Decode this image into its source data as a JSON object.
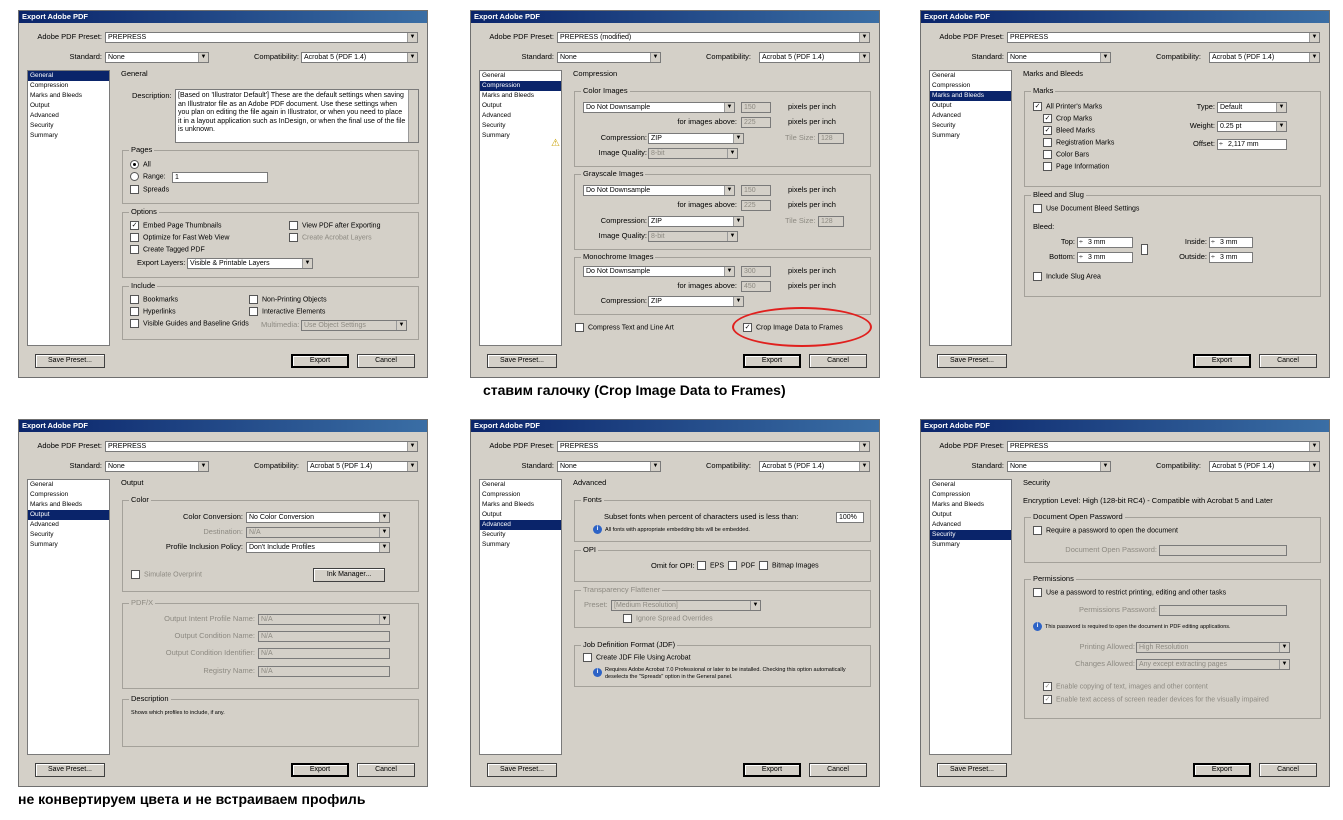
{
  "common": {
    "title": "Export Adobe PDF",
    "preset_label": "Adobe PDF Preset:",
    "standard_label": "Standard:",
    "compat_label": "Compatibility:",
    "standard_value": "None",
    "compat_value": "Acrobat 5 (PDF 1.4)",
    "sidebar": [
      "General",
      "Compression",
      "Marks and Bleeds",
      "Output",
      "Advanced",
      "Security",
      "Summary"
    ],
    "save_preset": "Save Preset...",
    "export": "Export",
    "cancel": "Cancel"
  },
  "d1": {
    "preset": "PREPRESS",
    "section": "General",
    "desc_label": "Description:",
    "desc": "[Based on 'Illustrator Default'] These are the default settings when saving an Illustrator file as an Adobe PDF document. Use these settings when you plan on editing the file again in Illustrator, or when you need to place it in a layout application such as InDesign, or when the final use of the file is unknown.",
    "pages": "Pages",
    "all": "All",
    "range": "Range:",
    "range_val": "1",
    "spreads": "Spreads",
    "options": "Options",
    "embed": "Embed Page Thumbnails",
    "optimize": "Optimize for Fast Web View",
    "tagged": "Create Tagged PDF",
    "view_after": "View PDF after Exporting",
    "acro_layers": "Create Acrobat Layers",
    "export_layers": "Export Layers:",
    "export_layers_val": "Visible & Printable Layers",
    "include": "Include",
    "bookmarks": "Bookmarks",
    "hyperlinks": "Hyperlinks",
    "guides": "Visible Guides and Baseline Grids",
    "nonprint": "Non-Printing Objects",
    "interactive": "Interactive Elements",
    "multimedia": "Multimedia:",
    "multimedia_val": "Use Object Settings"
  },
  "d2": {
    "preset": "PREPRESS (modified)",
    "section": "Compression",
    "color_images": "Color Images",
    "gray_images": "Grayscale Images",
    "mono_images": "Monochrome Images",
    "downsample": "Do Not Downsample",
    "ppi": "pixels per inch",
    "above": "for images above:",
    "compression": "Compression:",
    "zip": "ZIP",
    "quality": "Image Quality:",
    "bit8": "8-bit",
    "tile": "Tile Size:",
    "tile_val": "128",
    "v150": "150",
    "v225": "225",
    "v300": "300",
    "v450": "450",
    "compress_text": "Compress Text and Line Art",
    "crop": "Crop Image Data to Frames",
    "warn_icon": "warning-icon"
  },
  "d3": {
    "preset": "PREPRESS",
    "section": "Marks and Bleeds",
    "marks": "Marks",
    "all_marks": "All Printer's Marks",
    "crop_marks": "Crop Marks",
    "bleed_marks": "Bleed Marks",
    "reg_marks": "Registration Marks",
    "color_bars": "Color Bars",
    "page_info": "Page Information",
    "type": "Type:",
    "type_val": "Default",
    "weight": "Weight:",
    "weight_val": "0.25 pt",
    "offset": "Offset:",
    "offset_val": "2,117 mm",
    "bleed_slug": "Bleed and Slug",
    "use_doc_bleed": "Use Document Bleed Settings",
    "bleed": "Bleed:",
    "top": "Top:",
    "bottom": "Bottom:",
    "inside": "Inside:",
    "outside": "Outside:",
    "mm3": "3 mm",
    "slug": "Include Slug Area"
  },
  "d4": {
    "preset": "PREPRESS",
    "section": "Output",
    "color": "Color",
    "conv": "Color Conversion:",
    "conv_val": "No Color Conversion",
    "dest": "Destination:",
    "na": "N/A",
    "profile": "Profile Inclusion Policy:",
    "profile_val": "Don't Include Profiles",
    "simulate": "Simulate Overprint",
    "ink": "Ink Manager...",
    "pdfx": "PDF/X",
    "intent": "Output Intent Profile Name:",
    "cond_name": "Output Condition Name:",
    "cond_id": "Output Condition Identifier:",
    "registry": "Registry Name:",
    "description": "Description",
    "desc_text": "Shows which profiles to include, if any."
  },
  "d5": {
    "preset": "PREPRESS",
    "section": "Advanced",
    "fonts": "Fonts",
    "subset": "Subset fonts when percent of characters used is less than:",
    "subset_val": "100%",
    "fonts_note": "All fonts with appropriate embedding bits will be embedded.",
    "opi": "OPI",
    "omit": "Omit for OPI:",
    "eps": "EPS",
    "pdf": "PDF",
    "bitmap": "Bitmap Images",
    "flat": "Transparency Flattener",
    "preset_lbl": "Preset:",
    "preset_val": "[Medium Resolution]",
    "ignore": "Ignore Spread Overrides",
    "jdf": "Job Definition Format (JDF)",
    "create_jdf": "Create JDF File Using Acrobat",
    "jdf_note1": "Requires Adobe Acrobat 7.0 Professional or later to be installed. Checking this option automatically",
    "jdf_note2": "deselects the \"Spreads\" option in the General panel."
  },
  "d6": {
    "preset": "PREPRESS",
    "section": "Security",
    "encryption": "Encryption Level: High (128-bit RC4) - Compatible with Acrobat 5 and Later",
    "doc_open": "Document Open Password",
    "req_pw": "Require a password to open the document",
    "doc_open_pw": "Document Open Password:",
    "permissions": "Permissions",
    "use_pw": "Use a password to restrict printing, editing and other tasks",
    "perm_pw": "Permissions Password:",
    "perm_note": "This password is required to open the document in PDF editing applications.",
    "printing": "Printing Allowed:",
    "printing_val": "High Resolution",
    "changes": "Changes Allowed:",
    "changes_val": "Any except extracting pages",
    "enable_copy": "Enable copying of text, images and other content",
    "enable_access": "Enable text access of screen reader devices for the visually impaired"
  },
  "captions": {
    "crop": "ставим галочку (Crop Image Data to Frames)",
    "output": "не конвертируем цвета и не встраиваем профиль"
  },
  "colors": {
    "highlight": "#0a246a",
    "dialog": "#d4d0c8",
    "annotation": "#e0201e"
  }
}
